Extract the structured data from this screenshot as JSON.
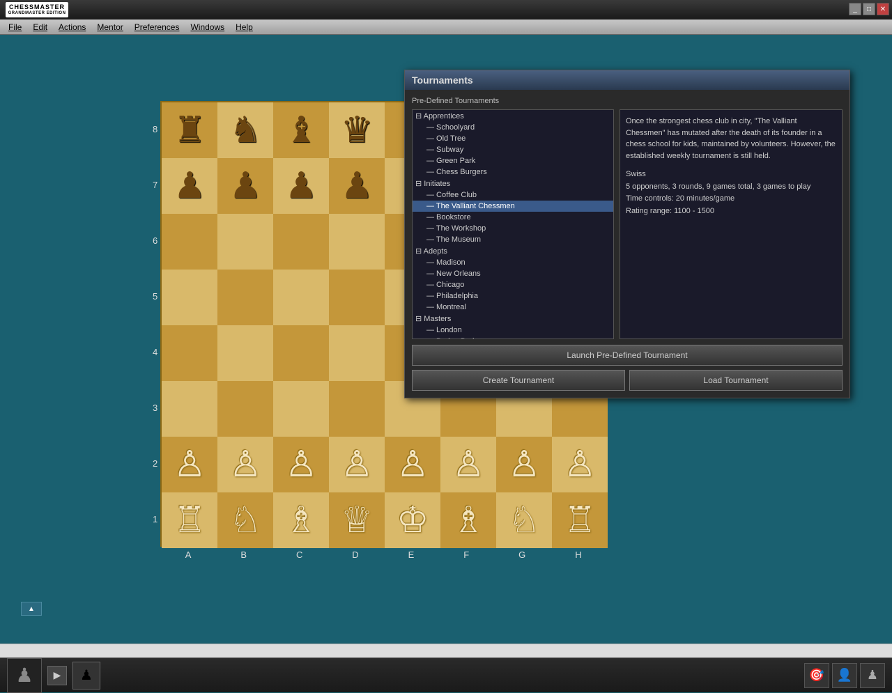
{
  "titlebar": {
    "app_name": "CHESSMASTER",
    "app_subtitle": "GRANDMASTER EDITION",
    "controls": [
      "minimize",
      "maximize",
      "close"
    ]
  },
  "menubar": {
    "items": [
      "File",
      "Edit",
      "Actions",
      "Mentor",
      "Preferences",
      "Windows",
      "Help"
    ]
  },
  "board": {
    "rank_labels": [
      "8",
      "7",
      "6",
      "5",
      "4",
      "3",
      "2",
      "1"
    ],
    "file_labels": [
      "A",
      "B",
      "C",
      "D",
      "E",
      "F",
      "G",
      "H"
    ]
  },
  "dialog": {
    "title": "Tournaments",
    "section_label": "Pre-Defined Tournaments",
    "tree": {
      "groups": [
        {
          "name": "Apprentices",
          "children": [
            "Schoolyard",
            "Old Tree",
            "Subway",
            "Green Park",
            "Chess Burgers"
          ]
        },
        {
          "name": "Initiates",
          "children": [
            "Coffee Club",
            "The Valliant Chessmen",
            "Bookstore",
            "The Workshop",
            "The Museum"
          ]
        },
        {
          "name": "Adepts",
          "children": [
            "Madison",
            "New Orleans",
            "Chicago",
            "Philadelphia",
            "Montreal"
          ]
        },
        {
          "name": "Masters",
          "children": [
            "London",
            "Baden Baden"
          ]
        }
      ],
      "selected": "The Valliant Chessmen"
    },
    "info": {
      "description": "Once the strongest chess club in city, \"The Valliant Chessmen\" has mutated after the death of its founder in a chess school for kids, maintained by volunteers. However, the established weekly tournament is still held.",
      "format": "Swiss",
      "opponents": "5 opponents, 3 rounds, 9 games total, 3 games to play",
      "time_controls": "Time controls: 20 minutes/game",
      "rating_range": "Rating range: 1100 - 1500"
    },
    "buttons": {
      "launch": "Launch Pre-Defined Tournament",
      "create": "Create Tournament",
      "load": "Load Tournament"
    }
  },
  "bottom_icons": {
    "play_label": "▶",
    "icons": [
      "🎯",
      "👤",
      "♟"
    ]
  }
}
